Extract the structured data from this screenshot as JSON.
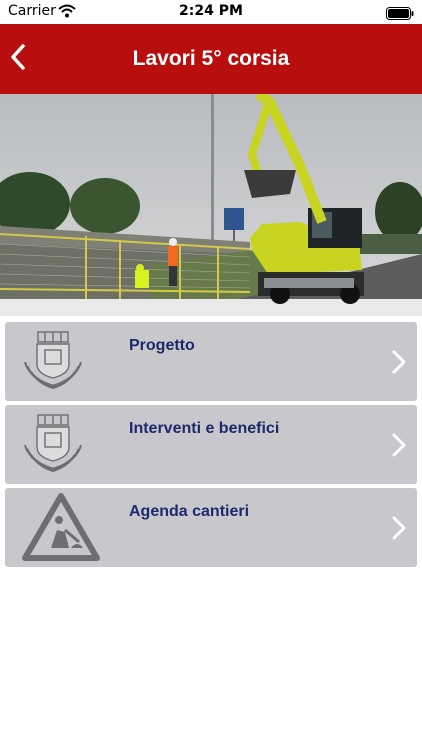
{
  "status_bar": {
    "carrier": "Carrier",
    "time": "2:24 PM"
  },
  "nav": {
    "title": "Lavori 5° corsia",
    "back_icon": "chevron-left-icon"
  },
  "hero": {
    "description_icon": "construction-photo"
  },
  "menu": {
    "items": [
      {
        "label": "Progetto",
        "icon": "coat-of-arms-icon"
      },
      {
        "label": "Interventi e benefici",
        "icon": "coat-of-arms-icon"
      },
      {
        "label": "Agenda cantieri",
        "icon": "roadworks-sign-icon"
      }
    ]
  },
  "colors": {
    "nav_red": "#b90e0e",
    "menu_bg": "#c8c8cc",
    "menu_label": "#1c2a6b"
  }
}
